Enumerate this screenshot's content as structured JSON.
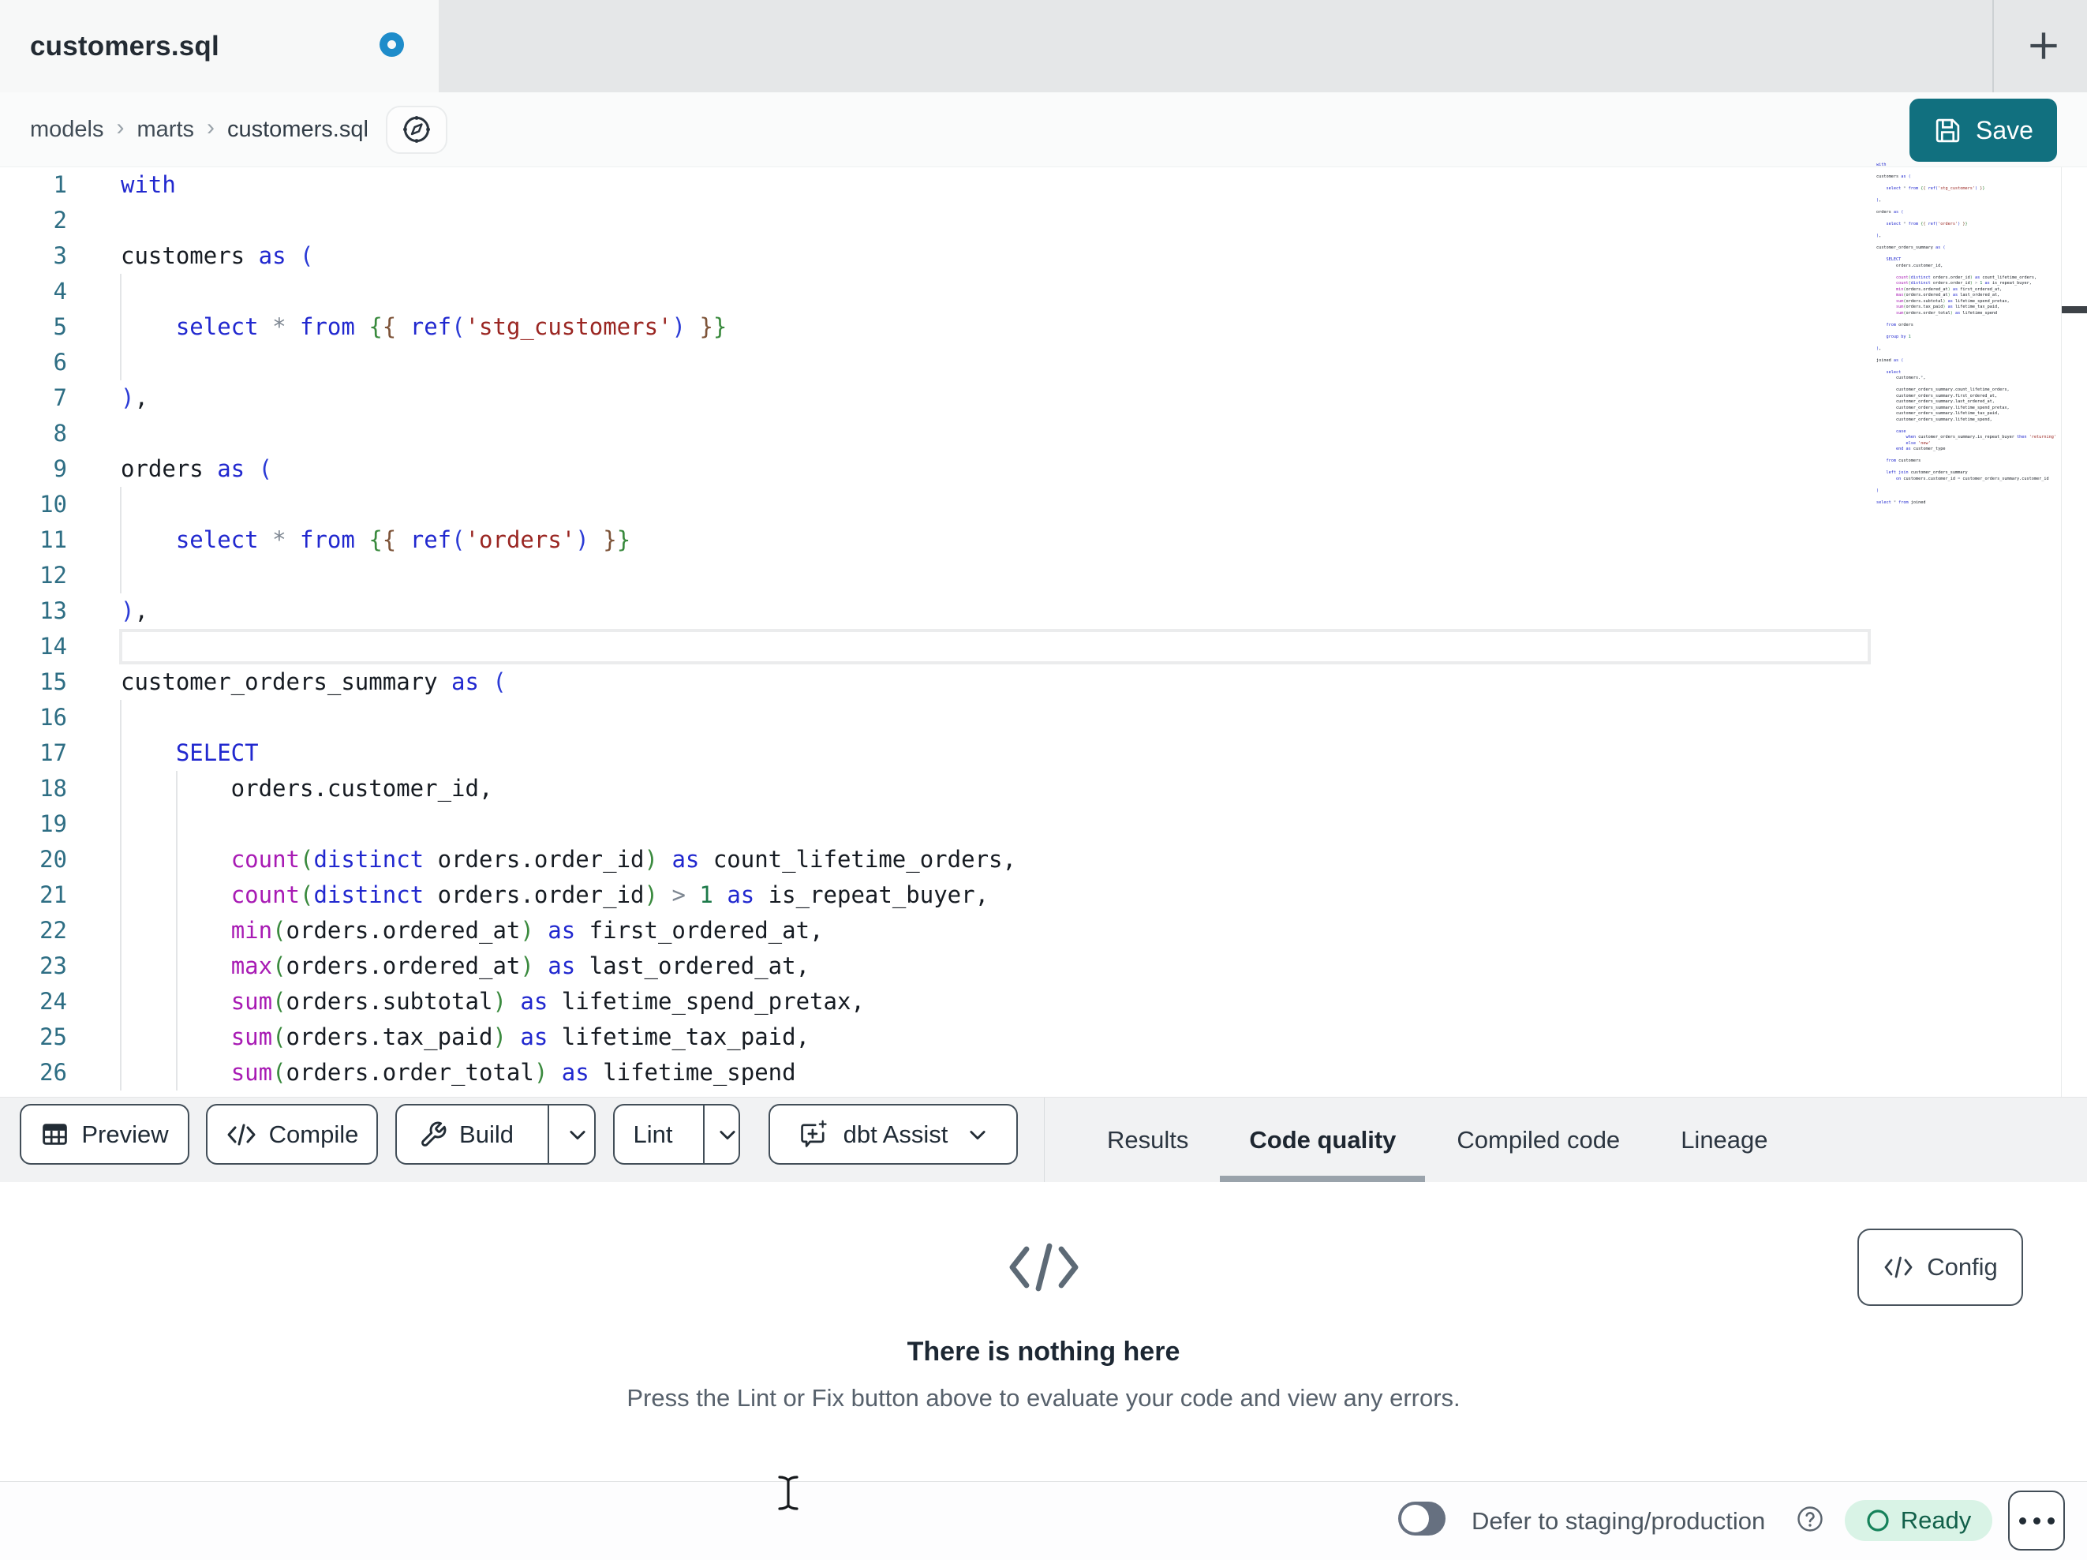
{
  "tabbar": {
    "title": "customers.sql",
    "unsaved": true,
    "new_tab_label": "+"
  },
  "breadcrumb": {
    "items": [
      "models",
      "marts",
      "customers.sql"
    ],
    "separator": "›"
  },
  "save_button": {
    "label": "Save"
  },
  "editor": {
    "visible_line_count": 26,
    "active_line": 14,
    "language": "sql",
    "token_styles": {
      "kw": "#2128cf",
      "fn": "#a81bb4",
      "str": "#9a2622",
      "num": "#1d7a4a",
      "op": "#7d8691",
      "b1": "#2b3bd6",
      "b2": "#3a8a3e",
      "b3": "#7d5338",
      "tx": "#161b22"
    },
    "lines": [
      [
        [
          "kw",
          "with"
        ]
      ],
      [],
      [
        [
          "tx",
          "customers "
        ],
        [
          "kw",
          "as"
        ],
        [
          "tx",
          " "
        ],
        [
          "b1",
          "("
        ]
      ],
      [],
      [
        [
          "tx",
          "    "
        ],
        [
          "kw",
          "select"
        ],
        [
          "tx",
          " "
        ],
        [
          "op",
          "*"
        ],
        [
          "tx",
          " "
        ],
        [
          "kw",
          "from"
        ],
        [
          "tx",
          " "
        ],
        [
          "b2",
          "{"
        ],
        [
          "b3",
          "{"
        ],
        [
          "tx",
          " "
        ],
        [
          "kw",
          "ref"
        ],
        [
          "b1",
          "("
        ],
        [
          "str",
          "'stg_customers'"
        ],
        [
          "b1",
          ")"
        ],
        [
          "tx",
          " "
        ],
        [
          "b3",
          "}"
        ],
        [
          "b2",
          "}"
        ]
      ],
      [],
      [
        [
          "b1",
          ")"
        ],
        [
          "tx",
          ","
        ]
      ],
      [],
      [
        [
          "tx",
          "orders "
        ],
        [
          "kw",
          "as"
        ],
        [
          "tx",
          " "
        ],
        [
          "b1",
          "("
        ]
      ],
      [],
      [
        [
          "tx",
          "    "
        ],
        [
          "kw",
          "select"
        ],
        [
          "tx",
          " "
        ],
        [
          "op",
          "*"
        ],
        [
          "tx",
          " "
        ],
        [
          "kw",
          "from"
        ],
        [
          "tx",
          " "
        ],
        [
          "b2",
          "{"
        ],
        [
          "b3",
          "{"
        ],
        [
          "tx",
          " "
        ],
        [
          "kw",
          "ref"
        ],
        [
          "b1",
          "("
        ],
        [
          "str",
          "'orders'"
        ],
        [
          "b1",
          ")"
        ],
        [
          "tx",
          " "
        ],
        [
          "b3",
          "}"
        ],
        [
          "b2",
          "}"
        ]
      ],
      [],
      [
        [
          "b1",
          ")"
        ],
        [
          "tx",
          ","
        ]
      ],
      [],
      [
        [
          "tx",
          "customer_orders_summary "
        ],
        [
          "kw",
          "as"
        ],
        [
          "tx",
          " "
        ],
        [
          "b1",
          "("
        ]
      ],
      [],
      [
        [
          "tx",
          "    "
        ],
        [
          "kw",
          "SELECT"
        ]
      ],
      [
        [
          "tx",
          "        orders.customer_id,"
        ]
      ],
      [],
      [
        [
          "tx",
          "        "
        ],
        [
          "fn",
          "count"
        ],
        [
          "b2",
          "("
        ],
        [
          "kw",
          "distinct"
        ],
        [
          "tx",
          " orders.order_id"
        ],
        [
          "b2",
          ")"
        ],
        [
          "tx",
          " "
        ],
        [
          "kw",
          "as"
        ],
        [
          "tx",
          " count_lifetime_orders,"
        ]
      ],
      [
        [
          "tx",
          "        "
        ],
        [
          "fn",
          "count"
        ],
        [
          "b2",
          "("
        ],
        [
          "kw",
          "distinct"
        ],
        [
          "tx",
          " orders.order_id"
        ],
        [
          "b2",
          ")"
        ],
        [
          "tx",
          " "
        ],
        [
          "op",
          ">"
        ],
        [
          "tx",
          " "
        ],
        [
          "num",
          "1"
        ],
        [
          "tx",
          " "
        ],
        [
          "kw",
          "as"
        ],
        [
          "tx",
          " is_repeat_buyer,"
        ]
      ],
      [
        [
          "tx",
          "        "
        ],
        [
          "fn",
          "min"
        ],
        [
          "b2",
          "("
        ],
        [
          "tx",
          "orders.ordered_at"
        ],
        [
          "b2",
          ")"
        ],
        [
          "tx",
          " "
        ],
        [
          "kw",
          "as"
        ],
        [
          "tx",
          " first_ordered_at,"
        ]
      ],
      [
        [
          "tx",
          "        "
        ],
        [
          "fn",
          "max"
        ],
        [
          "b2",
          "("
        ],
        [
          "tx",
          "orders.ordered_at"
        ],
        [
          "b2",
          ")"
        ],
        [
          "tx",
          " "
        ],
        [
          "kw",
          "as"
        ],
        [
          "tx",
          " last_ordered_at,"
        ]
      ],
      [
        [
          "tx",
          "        "
        ],
        [
          "fn",
          "sum"
        ],
        [
          "b2",
          "("
        ],
        [
          "tx",
          "orders.subtotal"
        ],
        [
          "b2",
          ")"
        ],
        [
          "tx",
          " "
        ],
        [
          "kw",
          "as"
        ],
        [
          "tx",
          " lifetime_spend_pretax,"
        ]
      ],
      [
        [
          "tx",
          "        "
        ],
        [
          "fn",
          "sum"
        ],
        [
          "b2",
          "("
        ],
        [
          "tx",
          "orders.tax_paid"
        ],
        [
          "b2",
          ")"
        ],
        [
          "tx",
          " "
        ],
        [
          "kw",
          "as"
        ],
        [
          "tx",
          " lifetime_tax_paid,"
        ]
      ],
      [
        [
          "tx",
          "        "
        ],
        [
          "fn",
          "sum"
        ],
        [
          "b2",
          "("
        ],
        [
          "tx",
          "orders.order_total"
        ],
        [
          "b2",
          ")"
        ],
        [
          "tx",
          " "
        ],
        [
          "kw",
          "as"
        ],
        [
          "tx",
          " lifetime_spend"
        ]
      ],
      [],
      [
        [
          "tx",
          "    "
        ],
        [
          "kw",
          "from"
        ],
        [
          "tx",
          " orders"
        ]
      ],
      [],
      [
        [
          "tx",
          "    "
        ],
        [
          "kw",
          "group"
        ],
        [
          "tx",
          " "
        ],
        [
          "kw",
          "by"
        ],
        [
          "tx",
          " "
        ],
        [
          "num",
          "1"
        ]
      ],
      [],
      [
        [
          "b1",
          ")"
        ],
        [
          "tx",
          ","
        ]
      ],
      [],
      [
        [
          "tx",
          "joined "
        ],
        [
          "kw",
          "as"
        ],
        [
          "tx",
          " "
        ],
        [
          "b1",
          "("
        ]
      ],
      [],
      [
        [
          "tx",
          "    "
        ],
        [
          "kw",
          "select"
        ]
      ],
      [
        [
          "tx",
          "        customers."
        ],
        [
          "op",
          "*"
        ],
        [
          "tx",
          ","
        ]
      ],
      [],
      [
        [
          "tx",
          "        customer_orders_summary.count_lifetime_orders,"
        ]
      ],
      [
        [
          "tx",
          "        customer_orders_summary.first_ordered_at,"
        ]
      ],
      [
        [
          "tx",
          "        customer_orders_summary.last_ordered_at,"
        ]
      ],
      [
        [
          "tx",
          "        customer_orders_summary.lifetime_spend_pretax,"
        ]
      ],
      [
        [
          "tx",
          "        customer_orders_summary.lifetime_tax_paid,"
        ]
      ],
      [
        [
          "tx",
          "        customer_orders_summary.lifetime_spend,"
        ]
      ],
      [],
      [
        [
          "tx",
          "        "
        ],
        [
          "kw",
          "case"
        ]
      ],
      [
        [
          "tx",
          "            "
        ],
        [
          "kw",
          "when"
        ],
        [
          "tx",
          " customer_orders_summary.is_repeat_buyer "
        ],
        [
          "kw",
          "then"
        ],
        [
          "tx",
          " "
        ],
        [
          "str",
          "'returning'"
        ]
      ],
      [
        [
          "tx",
          "            "
        ],
        [
          "kw",
          "else"
        ],
        [
          "tx",
          " "
        ],
        [
          "str",
          "'new'"
        ]
      ],
      [
        [
          "tx",
          "        "
        ],
        [
          "kw",
          "end"
        ],
        [
          "tx",
          " "
        ],
        [
          "kw",
          "as"
        ],
        [
          "tx",
          " customer_type"
        ]
      ],
      [],
      [
        [
          "tx",
          "    "
        ],
        [
          "kw",
          "from"
        ],
        [
          "tx",
          " customers"
        ]
      ],
      [],
      [
        [
          "tx",
          "    "
        ],
        [
          "kw",
          "left"
        ],
        [
          "tx",
          " "
        ],
        [
          "kw",
          "join"
        ],
        [
          "tx",
          " customer_orders_summary"
        ]
      ],
      [
        [
          "tx",
          "        "
        ],
        [
          "kw",
          "on"
        ],
        [
          "tx",
          " customers.customer_id "
        ],
        [
          "op",
          "="
        ],
        [
          "tx",
          " customer_orders_summary.customer_id"
        ]
      ],
      [],
      [
        [
          "b1",
          ")"
        ]
      ],
      [],
      [
        [
          "kw",
          "select"
        ],
        [
          "tx",
          " "
        ],
        [
          "op",
          "*"
        ],
        [
          "tx",
          " "
        ],
        [
          "kw",
          "from"
        ],
        [
          "tx",
          " joined"
        ]
      ]
    ]
  },
  "toolbar": {
    "preview_label": "Preview",
    "compile_label": "Compile",
    "build_label": "Build",
    "lint_label": "Lint",
    "assist_label": "dbt Assist"
  },
  "panel": {
    "tabs": [
      {
        "label": "Results",
        "active": false
      },
      {
        "label": "Code quality",
        "active": true
      },
      {
        "label": "Compiled code",
        "active": false
      },
      {
        "label": "Lineage",
        "active": false
      }
    ],
    "empty_title": "There is nothing here",
    "empty_subtitle": "Press the Lint or Fix button above to evaluate your code and view any errors.",
    "config_label": "Config"
  },
  "statusbar": {
    "defer_label": "Defer to staging/production",
    "defer_on": false,
    "ready_label": "Ready"
  },
  "colors": {
    "accent_teal": "#11707f",
    "unsaved_blue": "#1e8cca",
    "ready_bg": "#d9f3e6",
    "ready_text": "#12604a",
    "tabbar_bg": "#e5e7e8",
    "strip_bg": "#f1f2f3"
  }
}
